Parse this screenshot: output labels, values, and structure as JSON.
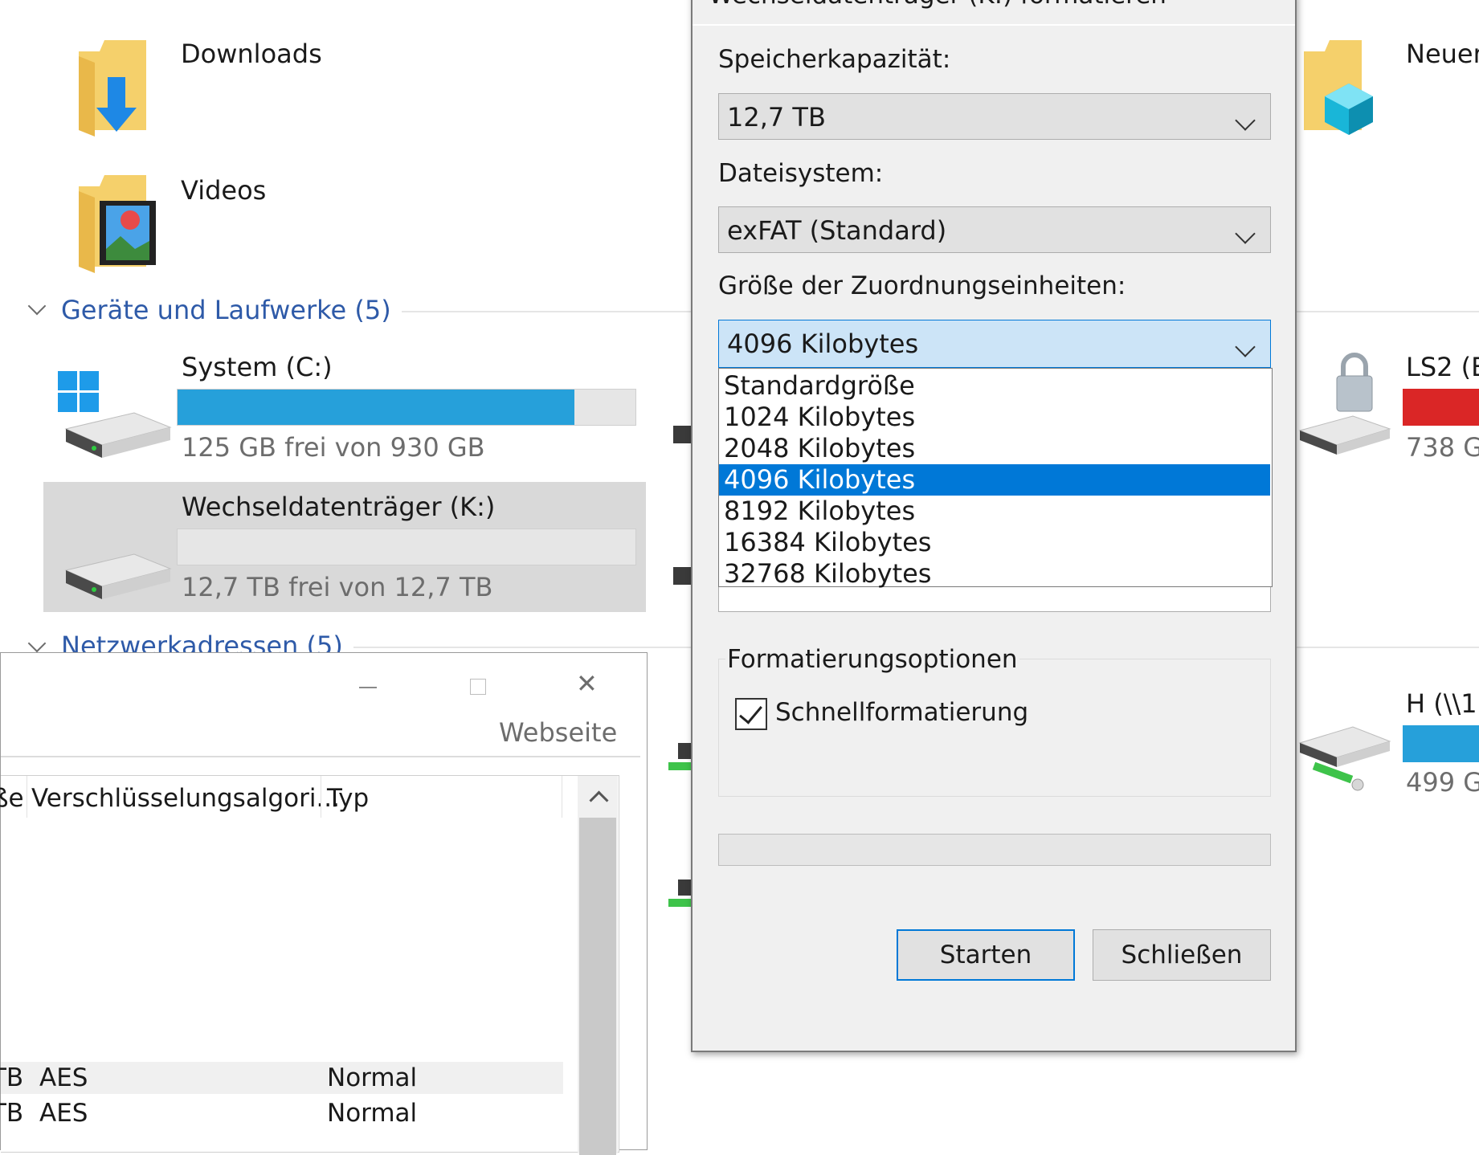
{
  "explorer": {
    "folders": [
      {
        "label": "Downloads",
        "icon": "downloads-folder-icon"
      },
      {
        "label": "Videos",
        "icon": "videos-folder-icon"
      }
    ],
    "right_folder": {
      "label": "Neuer",
      "icon": "3d-objects-folder-icon"
    },
    "devices_section": {
      "label": "Geräte und Laufwerke (5)"
    },
    "network_section": {
      "label": "Netzwerkadressen (5)"
    },
    "drives": [
      {
        "name": "System (C:)",
        "free_text": "125 GB frei von 930 GB",
        "used_fraction": 0.866,
        "bar_color": "#26a0da"
      },
      {
        "name": "Wechseldatenträger (K:)",
        "free_text": "12,7 TB frei von 12,7 TB",
        "used_fraction": 0.0,
        "bar_color": "#26a0da"
      }
    ],
    "right_drives": [
      {
        "name": "LS2 (E",
        "free_text": "738 G",
        "bar_color": "#da2626",
        "icon": "locked-drive-icon"
      },
      {
        "name": "H (\\\\1",
        "free_text": "499 G",
        "bar_color": "#26a0da",
        "icon": "network-drive-icon"
      }
    ]
  },
  "format_dialog": {
    "title": "Wechseldatenträger (K:) formatieren",
    "capacity": {
      "label": "Speicherkapazität:",
      "value": "12,7 TB"
    },
    "filesystem": {
      "label": "Dateisystem:",
      "value": "exFAT (Standard)"
    },
    "allocation": {
      "label": "Größe der Zuordnungseinheiten:",
      "value": "4096 Kilobytes",
      "options": [
        "Standardgröße",
        "1024 Kilobytes",
        "2048 Kilobytes",
        "4096 Kilobytes",
        "8192 Kilobytes",
        "16384 Kilobytes",
        "32768 Kilobytes"
      ],
      "selected_index": 3
    },
    "options_group": {
      "label": "Formatierungsoptionen",
      "quick_format": {
        "label": "Schnellformatierung",
        "checked": true
      }
    },
    "buttons": {
      "start": "Starten",
      "close": "Schließen"
    }
  },
  "bitlocker_window": {
    "header_link": "Webseite",
    "columns": [
      "ße",
      "Verschlüsselungsalgori...",
      "Typ"
    ],
    "rows": [
      {
        "c0": "TB",
        "c1": "AES",
        "c2": "Normal"
      },
      {
        "c0": "TB",
        "c1": "AES",
        "c2": "Normal"
      }
    ]
  }
}
